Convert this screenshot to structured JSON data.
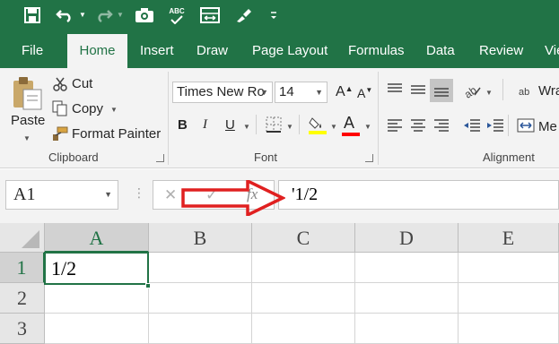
{
  "quick_access": {
    "items": [
      "save-icon",
      "undo-icon",
      "redo-icon",
      "camera-icon",
      "spelling-icon",
      "autofit-icon",
      "format-brush-icon",
      "customize-caret-icon"
    ],
    "spelling_label": "ABC"
  },
  "tabs": [
    "File",
    "Home",
    "Insert",
    "Draw",
    "Page Layout",
    "Formulas",
    "Data",
    "Review",
    "Vie"
  ],
  "active_tab": "Home",
  "clipboard": {
    "paste": "Paste",
    "cut": "Cut",
    "copy": "Copy",
    "format_painter": "Format Painter",
    "group_label": "Clipboard"
  },
  "font": {
    "font_name": "Times New Ro",
    "font_size": "14",
    "bold": "B",
    "italic": "I",
    "underline": "U",
    "font_color_letter": "A",
    "grow": "A",
    "shrink": "A",
    "group_label": "Font"
  },
  "alignment": {
    "wrap": "Wra",
    "merge": "Me",
    "group_label": "Alignment"
  },
  "formula_bar": {
    "name_box": "A1",
    "fx": "fx",
    "formula": "'1/2"
  },
  "sheet": {
    "columns": [
      "A",
      "B",
      "C",
      "D",
      "E"
    ],
    "rows": [
      "1",
      "2",
      "3"
    ],
    "cells": {
      "A1": "1/2"
    }
  },
  "colors": {
    "excel_green": "#217346",
    "arrow_red": "#e02020",
    "highlight_yellow": "#ffff00",
    "font_red": "#ff0000"
  }
}
